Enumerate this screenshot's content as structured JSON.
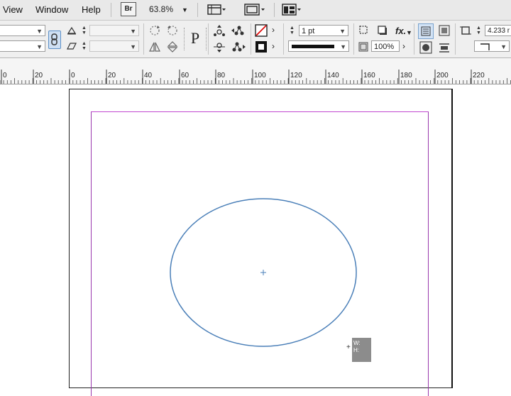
{
  "menubar": {
    "items": [
      "View",
      "Window",
      "Help"
    ],
    "bridge_badge": "Br",
    "zoom_level": "63.8%"
  },
  "control": {
    "stroke_weight": "1 pt",
    "opacity": "100%",
    "effects_label": "fx.",
    "reference_value": "4.233 r",
    "ptext_icon_label": "P",
    "icons": {
      "link": "link-proportions-icon",
      "rotate_cw": "rotate-clockwise-icon",
      "rotate_ccw": "rotate-counterclockwise-icon",
      "flip_h": "flip-horizontal-icon",
      "flip_v": "flip-vertical-icon",
      "fill_swatch": "fill-none-swatch-icon",
      "stroke_swatch": "stroke-swatch-icon"
    }
  },
  "ruler": {
    "labels": [
      "0",
      "20",
      "0",
      "20",
      "40",
      "60",
      "80",
      "100",
      "120",
      "140",
      "160",
      "180",
      "200",
      "220"
    ]
  },
  "canvas": {
    "cursor_tooltip": [
      "W:",
      "H:"
    ],
    "colors": {
      "margin_guide": "#c24ad1",
      "ellipse_stroke": "#4a7fb8",
      "page_border": "#222222"
    }
  }
}
